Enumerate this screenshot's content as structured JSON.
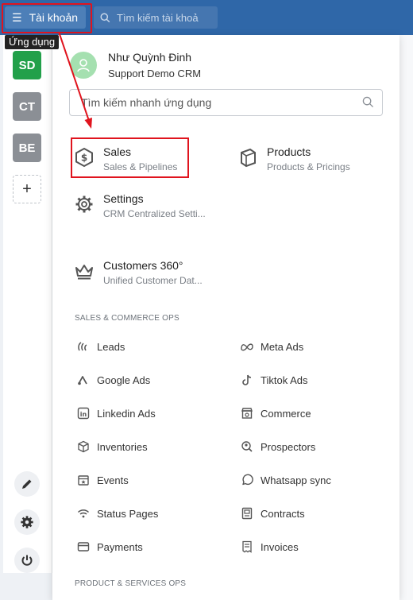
{
  "topbar": {
    "menu_label": "Tài khoản",
    "search_placeholder": "Tìm kiếm tài khoả"
  },
  "tooltip": "Ứng dụng",
  "workspaces": [
    "SD",
    "CT",
    "BE"
  ],
  "add_workspace": "+",
  "user": {
    "name": "Như Quỳnh Đinh",
    "org": "Support Demo CRM"
  },
  "app_search": {
    "placeholder": "Tìm kiếm nhanh ứng dụng"
  },
  "apps": [
    {
      "title": "Sales",
      "subtitle": "Sales & Pipelines",
      "icon": "sales-icon"
    },
    {
      "title": "Products",
      "subtitle": "Products & Pricings",
      "icon": "products-icon"
    },
    {
      "title": "Settings",
      "subtitle": "CRM Centralized Setti...",
      "icon": "gear-icon"
    },
    {
      "title": "Customers 360°",
      "subtitle": "Unified Customer Dat...",
      "icon": "crown-icon"
    }
  ],
  "sections": {
    "sales_commerce": "SALES & COMMERCE OPS",
    "product_services": "PRODUCT & SERVICES OPS"
  },
  "items": {
    "leads": "Leads",
    "meta_ads": "Meta Ads",
    "google_ads": "Google Ads",
    "tiktok_ads": "Tiktok Ads",
    "linkedin_ads": "Linkedin Ads",
    "commerce": "Commerce",
    "inventories": "Inventories",
    "prospectors": "Prospectors",
    "events": "Events",
    "whatsapp": "Whatsapp sync",
    "status_pages": "Status Pages",
    "contracts": "Contracts",
    "payments": "Payments",
    "invoices": "Invoices"
  },
  "colors": {
    "topbar": "#2f67a8",
    "highlight": "#e0141e",
    "workspace_active": "#22a04a"
  }
}
